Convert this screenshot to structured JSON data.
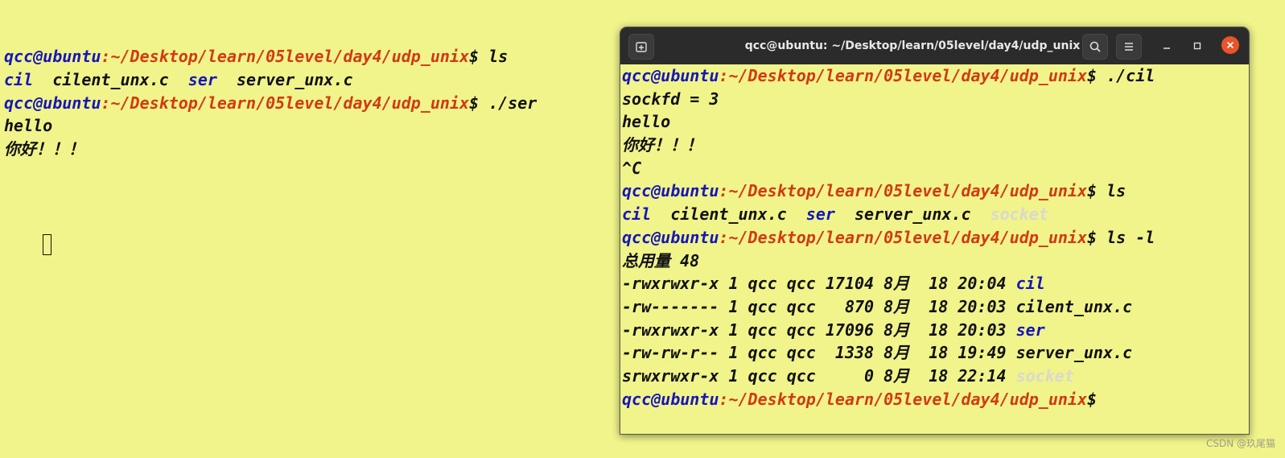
{
  "background_terminal": {
    "lines": [
      {
        "user": "qcc@ubuntu",
        "path": ":~/Desktop/learn/05level/day4/udp_unix",
        "cmd": "$ ls"
      },
      {
        "items": [
          {
            "t": "cil",
            "k": "dir"
          },
          {
            "t": "  cilent_unx.c  ",
            "k": "plain"
          },
          {
            "t": "ser",
            "k": "dir"
          },
          {
            "t": "  server_unx.c",
            "k": "plain"
          }
        ]
      },
      {
        "user": "qcc@ubuntu",
        "path": ":~/Desktop/learn/05level/day4/udp_unix",
        "cmd": "$ ./ser"
      },
      {
        "text": "hello"
      },
      {
        "text": "你好！！！"
      }
    ]
  },
  "front_window": {
    "title": "qcc@ubuntu: ~/Desktop/learn/05level/day4/udp_unix",
    "icons": {
      "new_tab": "new-tab-icon",
      "search": "search-icon",
      "menu": "hamburger-menu-icon",
      "minimize": "minimize-icon",
      "maximize": "maximize-icon",
      "close": "close-icon"
    },
    "lines": [
      {
        "user": "qcc@ubuntu",
        "path": ":~/Desktop/learn/05level/day4/udp_unix",
        "cmd": "$ ./cil"
      },
      {
        "text": "sockfd = 3"
      },
      {
        "text": "hello"
      },
      {
        "text": "你好！！！"
      },
      {
        "text": "^C"
      },
      {
        "user": "qcc@ubuntu",
        "path": ":~/Desktop/learn/05level/day4/udp_unix",
        "cmd": "$ ls"
      },
      {
        "items": [
          {
            "t": "cil",
            "k": "dir"
          },
          {
            "t": "  cilent_unx.c  ",
            "k": "plain"
          },
          {
            "t": "ser",
            "k": "dir"
          },
          {
            "t": "  server_unx.c  ",
            "k": "plain"
          },
          {
            "t": "socket",
            "k": "sock"
          }
        ]
      },
      {
        "user": "qcc@ubuntu",
        "path": ":~/Desktop/learn/05level/day4/udp_unix",
        "cmd": "$ ls -l"
      },
      {
        "text": "总用量 48"
      },
      {
        "items": [
          {
            "t": "-rwxrwxr-x 1 qcc qcc 17104 8月  18 20:04 ",
            "k": "plain"
          },
          {
            "t": "cil",
            "k": "dir"
          }
        ]
      },
      {
        "items": [
          {
            "t": "-rw------- 1 qcc qcc   870 8月  18 20:03 cilent_unx.c",
            "k": "plain"
          }
        ]
      },
      {
        "items": [
          {
            "t": "-rwxrwxr-x 1 qcc qcc 17096 8月  18 20:03 ",
            "k": "plain"
          },
          {
            "t": "ser",
            "k": "dir"
          }
        ]
      },
      {
        "items": [
          {
            "t": "-rw-rw-r-- 1 qcc qcc  1338 8月  18 19:49 server_unx.c",
            "k": "plain"
          }
        ]
      },
      {
        "items": [
          {
            "t": "srwxrwxr-x 1 qcc qcc     0 8月  18 22:14 ",
            "k": "plain"
          },
          {
            "t": "socket",
            "k": "sock"
          }
        ]
      },
      {
        "user": "qcc@ubuntu",
        "path": ":~/Desktop/learn/05level/day4/udp_unix",
        "cmd": "$"
      }
    ]
  },
  "watermark": "CSDN @玖尾猫",
  "colors": {
    "terminal_bg": "#f0f48a",
    "prompt_user": "#1616b8",
    "prompt_path": "#d23a14",
    "titlebar": "#2b2b2b",
    "close_button": "#e9542a"
  }
}
